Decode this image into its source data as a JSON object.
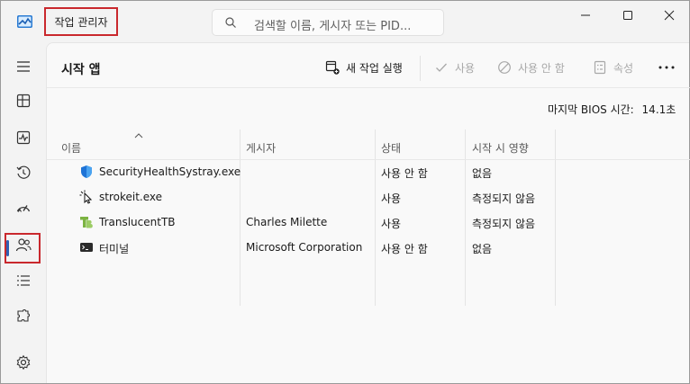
{
  "window": {
    "title": "작업 관리자",
    "search_placeholder": "검색할 이름, 게시자 또는 PID..."
  },
  "sidebar": {
    "items": [
      {
        "name": "menu",
        "icon": "hamburger-icon"
      },
      {
        "name": "processes",
        "icon": "processes-icon"
      },
      {
        "name": "performance",
        "icon": "performance-icon"
      },
      {
        "name": "app-history",
        "icon": "history-icon"
      },
      {
        "name": "startup-apps",
        "icon": "startup-speedometer-icon",
        "selected": true
      },
      {
        "name": "users",
        "icon": "users-icon"
      },
      {
        "name": "details",
        "icon": "details-list-icon"
      },
      {
        "name": "services",
        "icon": "services-puzzle-icon"
      },
      {
        "name": "settings",
        "icon": "gear-icon"
      }
    ]
  },
  "main": {
    "page_title": "시작 앱",
    "toolbar": {
      "new_task": "새 작업 실행",
      "enable": "사용",
      "disable": "사용 안 함",
      "properties": "속성"
    },
    "bios_label": "마지막 BIOS 시간:",
    "bios_value": "14.1초"
  },
  "table": {
    "columns": [
      "이름",
      "게시자",
      "상태",
      "시작 시 영향"
    ],
    "rows": [
      {
        "icon": "security-shield-icon",
        "name": "SecurityHealthSystray.exe",
        "publisher": "",
        "status": "사용 안 함",
        "impact": "없음"
      },
      {
        "icon": "pointer-icon",
        "name": "strokeit.exe",
        "publisher": "",
        "status": "사용",
        "impact": "측정되지 않음"
      },
      {
        "icon": "translucenttb-icon",
        "name": "TranslucentTB",
        "publisher": "Charles Milette",
        "status": "사용",
        "impact": "측정되지 않음"
      },
      {
        "icon": "terminal-icon",
        "name": "터미널",
        "publisher": "Microsoft Corporation",
        "status": "사용 안 함",
        "impact": "없음"
      }
    ]
  }
}
